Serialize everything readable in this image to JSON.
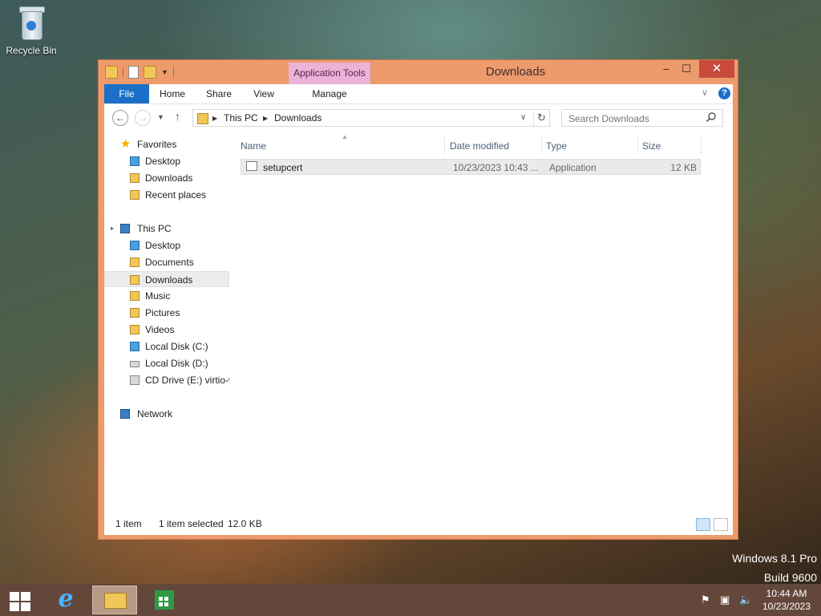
{
  "desktop": {
    "recycle_bin": "Recycle Bin"
  },
  "window": {
    "title": "Downloads",
    "context_tab": "Application Tools",
    "controls": {
      "minimize": "‒",
      "maximize": "☐",
      "close": "✕"
    }
  },
  "ribbon": {
    "tabs": {
      "file": "File",
      "home": "Home",
      "share": "Share",
      "view": "View",
      "manage": "Manage"
    },
    "help": "?"
  },
  "address_bar": {
    "crumbs": [
      "This PC",
      "Downloads"
    ]
  },
  "search": {
    "placeholder": "Search Downloads"
  },
  "nav": {
    "favorites": "Favorites",
    "fav_items": [
      "Desktop",
      "Downloads",
      "Recent places"
    ],
    "this_pc": "This PC",
    "pc_items": [
      "Desktop",
      "Documents",
      "Downloads",
      "Music",
      "Pictures",
      "Videos",
      "Local Disk (C:)",
      "Local Disk (D:)",
      "CD Drive (E:) virtio-w"
    ],
    "network": "Network",
    "selected": "Downloads"
  },
  "columns": {
    "name": "Name",
    "date": "Date modified",
    "type": "Type",
    "size": "Size"
  },
  "files": [
    {
      "name": "setupcert",
      "date": "10/23/2023 10:43 ...",
      "type": "Application",
      "size": "12 KB"
    }
  ],
  "status": {
    "count": "1 item",
    "selected": "1 item selected",
    "size": "12.0 KB"
  },
  "watermark": {
    "line1": "Windows 8.1 Pro",
    "line2": "Build 9600"
  },
  "clock": {
    "time": "10:44 AM",
    "date": "10/23/2023"
  },
  "colors": {
    "accent": "#1b6fc7",
    "frame": "#ed9a6c",
    "close": "#c74a3d",
    "context_tab": "#eab3d7",
    "taskbar": "#64473b"
  }
}
